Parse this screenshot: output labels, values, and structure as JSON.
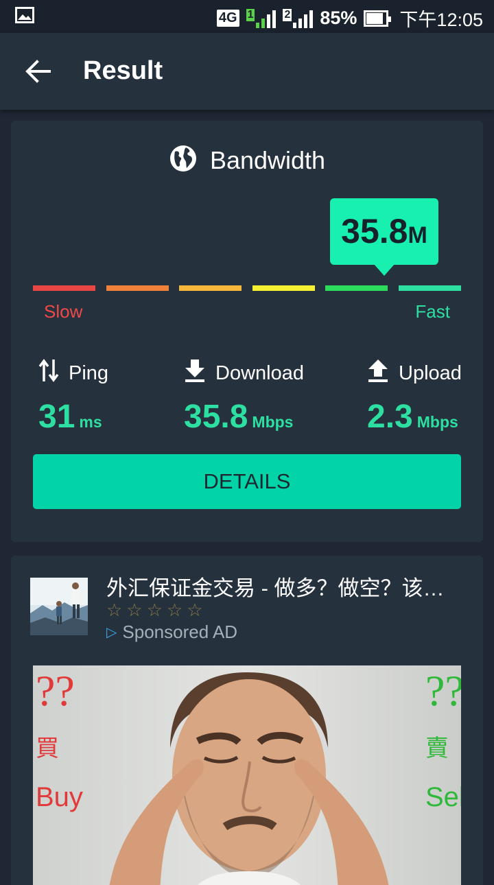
{
  "status_bar": {
    "network_type": "4G",
    "sim1_label": "1",
    "sim2_label": "2",
    "battery_percent": "85%",
    "time": "下午12:05"
  },
  "appbar": {
    "title": "Result"
  },
  "result": {
    "heading": "Bandwidth",
    "speed_value": "35.8",
    "speed_unit": "M",
    "scale_colors": [
      "#e84545",
      "#f0813a",
      "#f6b73a",
      "#f5f031",
      "#2bdc5d",
      "#2de0a2"
    ],
    "slow_label": "Slow",
    "fast_label": "Fast",
    "metrics": {
      "ping": {
        "label": "Ping",
        "value": "31",
        "unit": "ms"
      },
      "download": {
        "label": "Download",
        "value": "35.8",
        "unit": "Mbps"
      },
      "upload": {
        "label": "Upload",
        "value": "2.3",
        "unit": "Mbps"
      }
    },
    "details_button": "DETAILS"
  },
  "ad": {
    "title": "外汇保证金交易 - 做多？做空？该…",
    "stars": "☆☆☆☆☆",
    "sponsored": "Sponsored AD",
    "image_text": {
      "left_marks": "??",
      "right_marks": "??",
      "buy_cn": "買",
      "sell_cn": "賣",
      "buy_en": "Buy",
      "sell_en": "Sel"
    }
  },
  "colors": {
    "accent": "#2de0a2",
    "button": "#03d4a8",
    "bubble": "#18f0b0",
    "background": "#1e2733",
    "card": "#26313e"
  }
}
